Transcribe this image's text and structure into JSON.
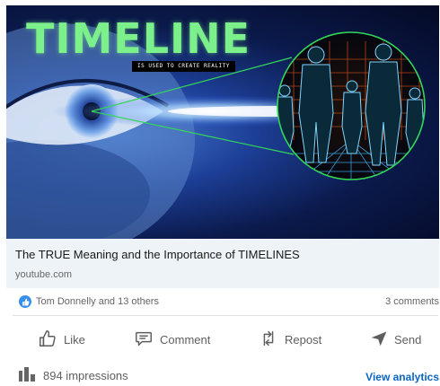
{
  "thumbnail": {
    "title_text": "TIMELINE",
    "subtitle_text": "IS USED TO CREATE REALITY"
  },
  "link": {
    "title": "The TRUE Meaning and the Importance of TIMELINES",
    "domain": "youtube.com"
  },
  "social": {
    "reactions_text": "Tom Donnelly and 13 others",
    "comments_text": "3 comments"
  },
  "actions": {
    "like": "Like",
    "comment": "Comment",
    "repost": "Repost",
    "send": "Send"
  },
  "footer": {
    "impressions": "894 impressions",
    "analytics_link": "View analytics"
  },
  "colors": {
    "accent_blue": "#0a66c2",
    "like_badge": "#378fe9",
    "title_green": "#7cf08a"
  }
}
